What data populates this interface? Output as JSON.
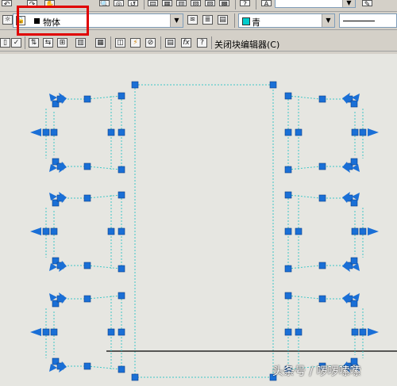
{
  "toolbar_top": {
    "icons": [
      "undo-icon",
      "redo-icon",
      "zoom-icon",
      "zoom-window-icon",
      "zoom-previous-icon",
      "properties-icon",
      "design-center-icon",
      "tool-palettes-icon",
      "markup-icon",
      "calculator-icon",
      "text-style-icon",
      "pencil-icon"
    ]
  },
  "layer_toolbar": {
    "layer_name": "物体",
    "color_name": "青",
    "colors": {
      "accent_red": "#e00000",
      "layer_swatch": "#000000",
      "color_swatch": "#00cccc"
    }
  },
  "block_editor_toolbar": {
    "close_label": "关闭块编辑器(C)"
  },
  "drawing": {
    "grip_color": "#1a6fd6",
    "dashed_color": "#3fc7c7"
  },
  "watermark": {
    "text": "头条号 / 啰啰嗦嗦"
  }
}
